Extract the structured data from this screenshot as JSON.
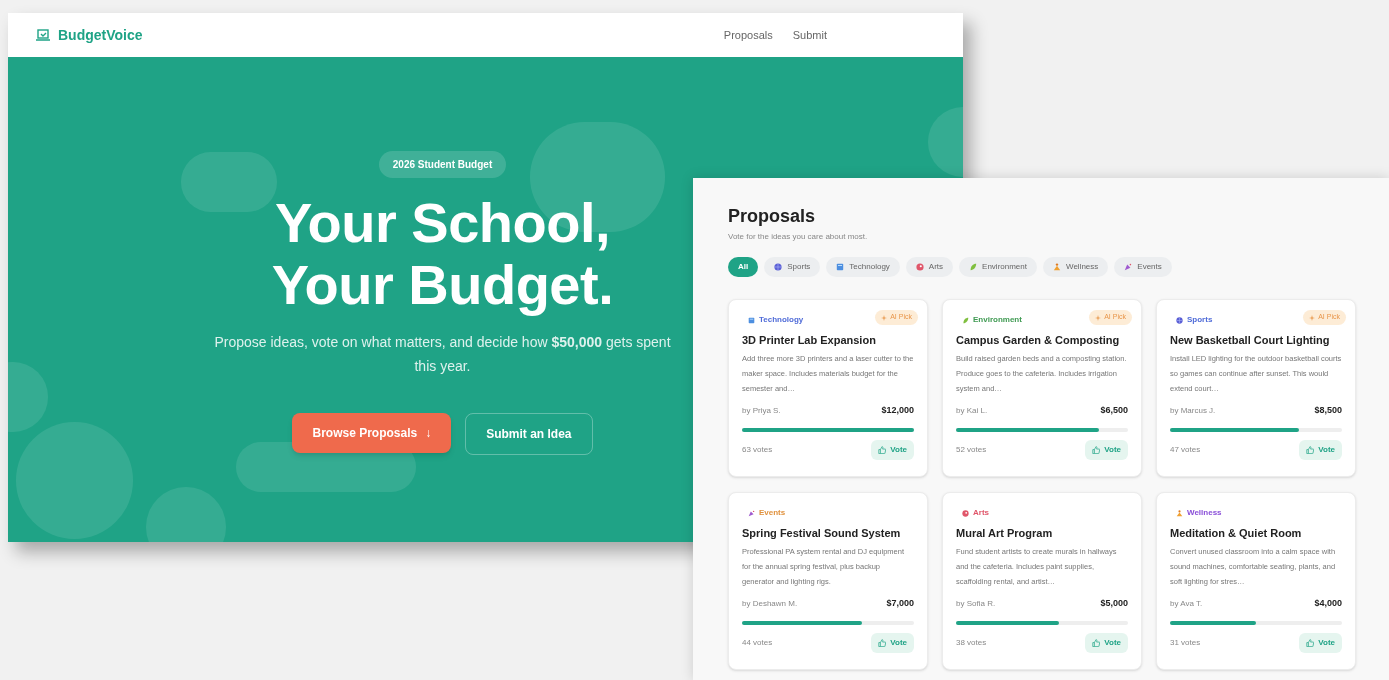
{
  "landing": {
    "brand": "BudgetVoice",
    "nav": [
      {
        "label": "Proposals"
      },
      {
        "label": "Submit"
      }
    ],
    "badge": "2026 Student Budget",
    "headline": [
      "Your School,",
      "Your Budget."
    ],
    "lead": "Propose ideas, vote on what matters, and decide how **$50,000** gets spent this year.",
    "buttons": [
      {
        "kind": "primary",
        "label": "Browse Proposals",
        "arrow": "↓"
      },
      {
        "kind": "outline",
        "label": "Submit an Idea"
      }
    ]
  },
  "proposals": {
    "title": "Proposals",
    "subtitle": "Vote for the ideas you care about most.",
    "filters": [
      {
        "kind": "all",
        "label": "All",
        "selected": true
      },
      {
        "kind": "sports",
        "label": "Sports",
        "selected": false
      },
      {
        "kind": "technology",
        "label": "Technology",
        "selected": false
      },
      {
        "kind": "arts",
        "label": "Arts",
        "selected": false
      },
      {
        "kind": "environment",
        "label": "Environment",
        "selected": false
      },
      {
        "kind": "wellness",
        "label": "Wellness",
        "selected": false
      },
      {
        "kind": "events",
        "label": "Events",
        "selected": false
      }
    ],
    "cards": [
      {
        "category": {
          "kind": "technology",
          "label": "Technology",
          "color": "#4f6bd8"
        },
        "ai_pick": "AI Pick",
        "title": "3D Printer Lab Expansion",
        "description": "Add three more 3D printers and a laser cutter to the maker space. Includes materials budget for the semester and…",
        "author": "by Priya S.",
        "amount": "$12,000",
        "level": 1.0,
        "votes": "63 votes",
        "vote_button": "Vote"
      },
      {
        "category": {
          "kind": "environment",
          "label": "Environment",
          "color": "#3f9a52"
        },
        "ai_pick": "AI Pick",
        "title": "Campus Garden & Composting",
        "description": "Build raised garden beds and a composting station. Produce goes to the cafeteria. Includes irrigation system and…",
        "author": "by Kai L.",
        "amount": "$6,500",
        "level": 0.83,
        "votes": "52 votes",
        "vote_button": "Vote"
      },
      {
        "category": {
          "kind": "sports",
          "label": "Sports",
          "color": "#4f6bd8"
        },
        "ai_pick": "AI Pick",
        "title": "New Basketball Court Lighting",
        "description": "Install LED lighting for the outdoor basketball courts so games can continue after sunset. This would extend court…",
        "author": "by Marcus J.",
        "amount": "$8,500",
        "level": 0.75,
        "votes": "47 votes",
        "vote_button": "Vote"
      },
      {
        "category": {
          "kind": "events",
          "label": "Events",
          "color": "#e0923f"
        },
        "title": "Spring Festival Sound System",
        "description": "Professional PA system rental and DJ equipment for the annual spring festival, plus backup generator and lighting rigs.",
        "author": "by Deshawn M.",
        "amount": "$7,000",
        "level": 0.7,
        "votes": "44 votes",
        "vote_button": "Vote"
      },
      {
        "category": {
          "kind": "arts",
          "label": "Arts",
          "color": "#e0566a"
        },
        "title": "Mural Art Program",
        "description": "Fund student artists to create murals in hallways and the cafeteria. Includes paint supplies, scaffolding rental, and artist…",
        "author": "by Sofia R.",
        "amount": "$5,000",
        "level": 0.6,
        "votes": "38 votes",
        "vote_button": "Vote"
      },
      {
        "category": {
          "kind": "wellness",
          "label": "Wellness",
          "color": "#8a4fd8"
        },
        "title": "Meditation & Quiet Room",
        "description": "Convert unused classroom into a calm space with sound machines, comfortable seating, plants, and soft lighting for stres…",
        "author": "by Ava T.",
        "amount": "$4,000",
        "level": 0.5,
        "votes": "31 votes",
        "vote_button": "Vote"
      }
    ]
  }
}
